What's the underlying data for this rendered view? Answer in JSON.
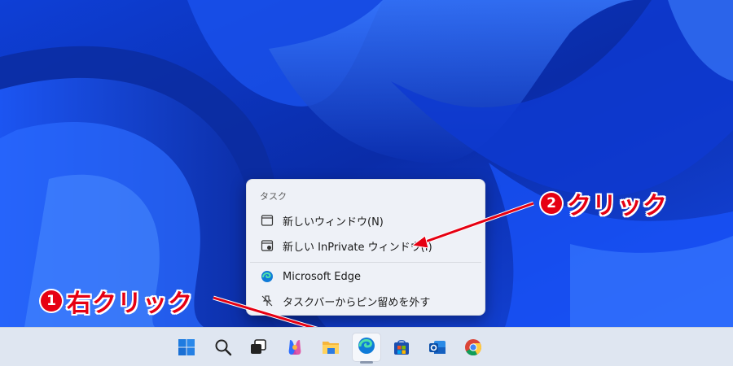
{
  "context_menu": {
    "header": "タスク",
    "items": [
      {
        "label": "新しいウィンドウ(N)",
        "icon": "window-icon"
      },
      {
        "label": "新しい InPrivate ウィンドウ(I)",
        "icon": "inprivate-window-icon"
      },
      {
        "label": "Microsoft Edge",
        "icon": "edge-icon"
      },
      {
        "label": "タスクバーからピン留めを外す",
        "icon": "unpin-icon"
      }
    ]
  },
  "annotations": {
    "step1": {
      "number": "1",
      "text": "右クリック"
    },
    "step2": {
      "number": "2",
      "text": "クリック"
    }
  },
  "taskbar": {
    "icons": [
      "windows-start-icon",
      "search-icon",
      "task-view-icon",
      "copilot-icon",
      "file-explorer-icon",
      "edge-icon",
      "store-icon",
      "outlook-icon",
      "chrome-icon"
    ],
    "active": "edge-icon"
  },
  "colors": {
    "annotation": "#e60012",
    "wallpaper": "#0a2fb8",
    "taskbar": "#dfe6f1",
    "menu": "#eef1f7"
  }
}
